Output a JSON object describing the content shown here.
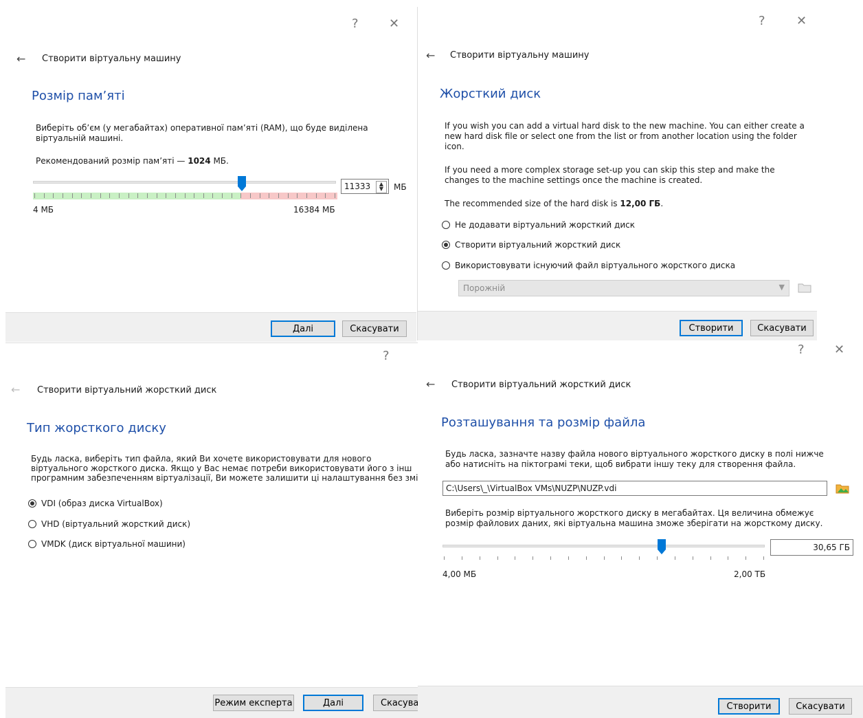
{
  "colors": {
    "heading": "#1e4fa8",
    "accent": "#0078d7",
    "footer": "#f0f0f0"
  },
  "p1": {
    "help": "?",
    "close": "✕",
    "back": "←",
    "window_title": "Створити віртуальну машину",
    "heading": "Розмір пам’яті",
    "desc": "Виберіть об’єм (у мегабайтах) оперативної пам’яті (RAM), що буде виділена віртуальній машині.",
    "rec_prefix": "Рекомендований розмір пам’яті — ",
    "rec_value": "1024",
    "rec_unit": " МБ.",
    "slider_min": "4 МБ",
    "slider_max": "16384 МБ",
    "value": "11333",
    "unit": "МБ",
    "slider_level": 0.69,
    "next": "Далі",
    "cancel": "Скасувати"
  },
  "p2": {
    "help": "?",
    "close": "✕",
    "back": "←",
    "window_title": "Створити віртуальну машину",
    "heading": "Жорсткий диск",
    "para1": "If you wish you can add a virtual hard disk to the new machine. You can either create a new hard disk file or select one from the list or from another location using the folder icon.",
    "para2": "If you need a more complex storage set-up you can skip this step and make the changes to the machine settings once the machine is created.",
    "rec_prefix": "The recommended size of the hard disk is ",
    "rec_value": "12,00 ГБ",
    "rec_suffix": ".",
    "opt1": "Не додавати віртуальний жорсткий диск",
    "opt2": "Створити віртуальний жорсткий диск",
    "opt3": "Використовувати існуючий файл віртуального жорсткого диска",
    "combo": "Порожній",
    "create": "Створити",
    "cancel": "Скасувати"
  },
  "p3": {
    "help": "?",
    "back": "←",
    "window_title": "Створити віртуальний жорсткий диск",
    "heading": "Тип жорсткого диску",
    "line1": "Будь ласка, виберіть тип файла, який Ви хочете використовувати для нового",
    "line2": "віртуального жорсткого диска. Якщо у Вас немає потреби використовувати його з інш",
    "line3": "програмним забезпеченням віртуалізації, Ви можете залишити ці налаштування без змін",
    "opt1": "VDI (образ диска VirtualBox)",
    "opt2": "VHD (віртуальний жорсткий диск)",
    "opt3": "VMDK (диск віртуальної машини)",
    "expert": "Режим експерта",
    "next": "Далі",
    "cancel": "Скасувати"
  },
  "p4": {
    "help": "?",
    "close": "✕",
    "back": "←",
    "window_title": "Створити віртуальний жорсткий диск",
    "heading": "Розташування та розмір файла",
    "desc": "Будь ласка, зазначте назву файла нового віртуального жорсткого диску в полі нижче або натисніть на піктограмі теки, щоб вибрати іншу теку для створення файла.",
    "path": "C:\\Users\\_\\VirtualBox VMs\\NUZP\\NUZP.vdi",
    "size_desc": "Виберіть розмір віртуального жорсткого диску в мегабайтах. Ця величина обмежує розмір файлових даних, які віртуальна машина зможе зберігати на жорсткому диску.",
    "slider_min": "4,00 МБ",
    "slider_max": "2,00 ТБ",
    "value": "30,65 ГБ",
    "slider_level": 0.68,
    "create": "Створити",
    "cancel": "Скасувати"
  }
}
